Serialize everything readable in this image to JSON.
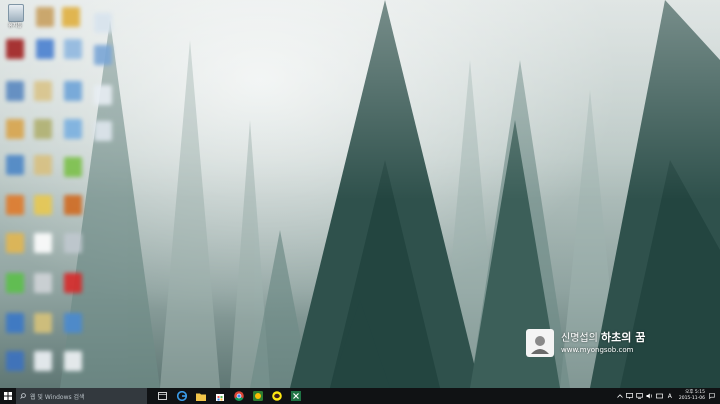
{
  "desktop": {
    "recycle_bin_label": "휴지통",
    "watermark": {
      "title_prefix": "신명섭의",
      "title_main": "하초의 꿈",
      "url": "www.myongsob.com"
    }
  },
  "taskbar": {
    "search_placeholder": "웹 및 Windows 검색",
    "apps": [
      "task-view",
      "edge",
      "file-explorer",
      "store",
      "chrome",
      "google-apps",
      "kakaotalk",
      "excel"
    ],
    "tray_icons": [
      "chevron-up",
      "display",
      "network",
      "volume",
      "keyboard",
      "ime"
    ],
    "ime_label": "A",
    "clock": {
      "time": "오후 5:15",
      "date": "2015-11-06"
    }
  },
  "colors": {
    "taskbar_bg": "#101214",
    "search_bg": "#33393e",
    "accent_blue": "#1e88e5"
  }
}
